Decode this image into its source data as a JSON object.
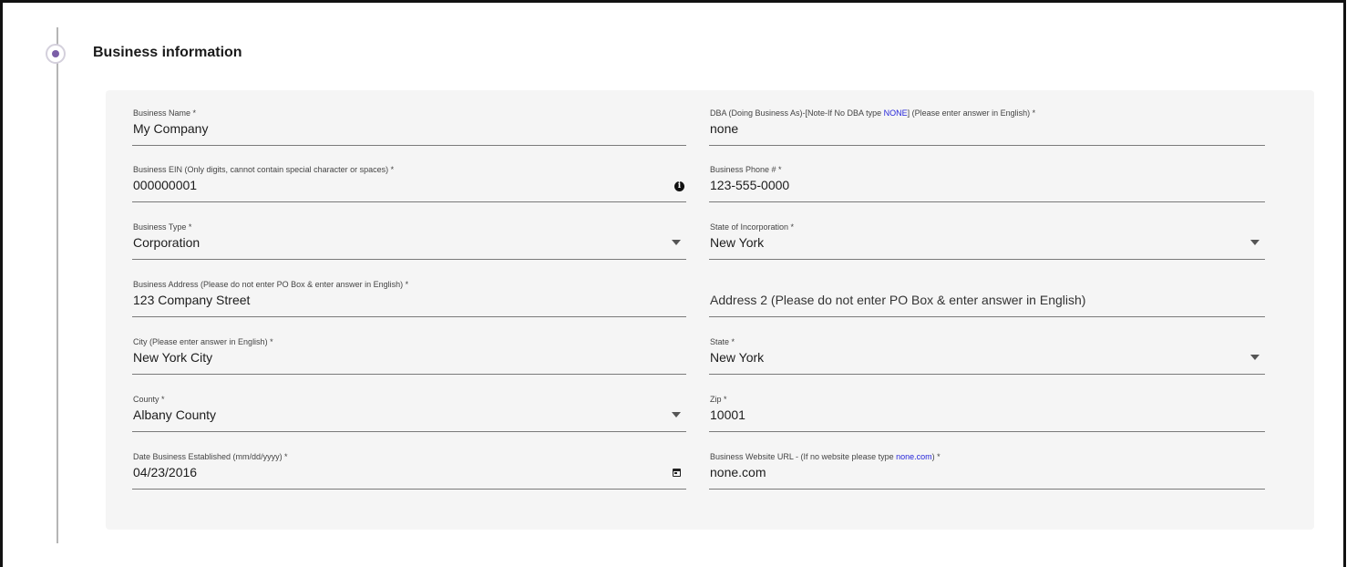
{
  "section": {
    "title": "Business information"
  },
  "fields": {
    "business_name": {
      "label": "Business Name *",
      "value": "My Company"
    },
    "dba": {
      "label_pre": "DBA (Doing Business As)-[Note-If No DBA type ",
      "label_hl": "NONE",
      "label_post": "] (Please enter answer in English) *",
      "value": "none"
    },
    "ein": {
      "label": "Business EIN (Only digits, cannot contain special character or spaces) *",
      "value": "000000001",
      "icon": "info-icon"
    },
    "phone": {
      "label": "Business Phone # *",
      "value": "123-555-0000"
    },
    "business_type": {
      "label": "Business Type *",
      "value": "Corporation"
    },
    "state_incorp": {
      "label": "State of Incorporation *",
      "value": "New York"
    },
    "address": {
      "label": "Business Address (Please do not enter PO Box & enter answer in English)  *",
      "value": "123 Company Street"
    },
    "address2": {
      "placeholder": "Address 2 (Please do not enter PO Box & enter answer in English)"
    },
    "city": {
      "label": "City (Please enter answer in English) *",
      "value": "New York City"
    },
    "state": {
      "label": "State *",
      "value": "New York"
    },
    "county": {
      "label": "County *",
      "value": "Albany County"
    },
    "zip": {
      "label": "Zip *",
      "value": "10001"
    },
    "date_established": {
      "label": "Date Business Established (mm/dd/yyyy) *",
      "value": "04/23/2016",
      "icon": "calendar-icon"
    },
    "website": {
      "label_pre": "Business Website URL - (If no website please type ",
      "label_hl": "none.com",
      "label_post": ") *",
      "value": "none.com"
    }
  },
  "colors": {
    "accent": "#7b5ea7",
    "highlight": "#2626d9",
    "panel_bg": "#f5f5f5"
  }
}
